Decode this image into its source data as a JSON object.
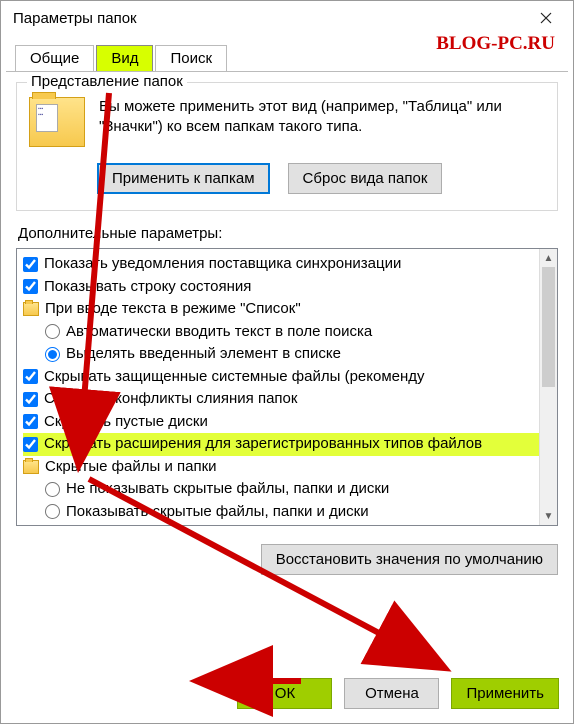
{
  "window": {
    "title": "Параметры папок"
  },
  "watermark": "BLOG-PC.RU",
  "tabs": {
    "general": "Общие",
    "view": "Вид",
    "search": "Поиск"
  },
  "group": {
    "legend": "Представление папок",
    "desc": "Вы можете применить этот вид (например, \"Таблица\" или \"Значки\") ко всем папкам такого типа.",
    "apply_btn": "Применить к папкам",
    "reset_btn": "Сброс вида папок"
  },
  "advanced": {
    "label": "Дополнительные параметры:",
    "items": [
      {
        "kind": "check",
        "checked": true,
        "text": "Показать уведомления поставщика синхронизации"
      },
      {
        "kind": "check",
        "checked": true,
        "text": "Показывать строку состояния"
      },
      {
        "kind": "folder",
        "text": "При вводе текста в режиме \"Список\""
      },
      {
        "kind": "radio",
        "checked": false,
        "indent": true,
        "text": "Автоматически вводить текст в поле поиска"
      },
      {
        "kind": "radio",
        "checked": true,
        "indent": true,
        "text": "Выделять введенный элемент в списке"
      },
      {
        "kind": "check",
        "checked": true,
        "text": "Скрывать защищенные системные файлы (рекоменду"
      },
      {
        "kind": "check",
        "checked": true,
        "text": "Скрывать конфликты слияния папок"
      },
      {
        "kind": "check",
        "checked": true,
        "text": "Скрывать пустые диски"
      },
      {
        "kind": "check",
        "checked": true,
        "hl": true,
        "text": "Скрывать расширения для зарегистрированных типов файлов"
      },
      {
        "kind": "folder",
        "text": "Скрытые файлы и папки"
      },
      {
        "kind": "radio",
        "checked": false,
        "indent": true,
        "text": "Не показывать скрытые файлы, папки и диски"
      },
      {
        "kind": "radio",
        "checked": false,
        "indent": true,
        "text": "Показывать скрытые файлы, папки и диски"
      }
    ],
    "restore_btn": "Восстановить значения по умолчанию"
  },
  "buttons": {
    "ok": "ОК",
    "cancel": "Отмена",
    "apply": "Применить"
  }
}
